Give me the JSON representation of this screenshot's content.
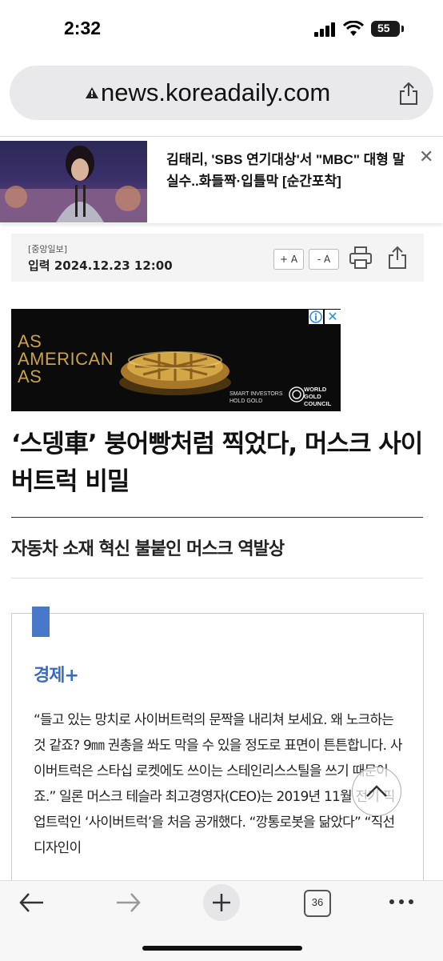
{
  "status_bar": {
    "time": "2:32",
    "battery": "55"
  },
  "browser": {
    "url": "news.koreadaily.com",
    "tab_count": "36"
  },
  "top_banner": {
    "title": "김태리, 'SBS 연기대상'서 \"MBC\" 대형 말실수..화들짝·입틀막 [순간포착]"
  },
  "article_meta": {
    "source": "[중앙일보]",
    "date": "입력 2024.12.23 12:00",
    "font_plus": "+ A",
    "font_minus": "- A"
  },
  "ad": {
    "headline_lines": [
      "AS",
      "AMERICAN",
      "AS"
    ],
    "tagline": "SMART INVESTORS\nHOLD GOLD",
    "brand": "WORLD\nGOLD\nCOUNCIL"
  },
  "article": {
    "headline": "‘스뎅車’ 붕어빵처럼 찍었다, 머스크 사이버트럭 비밀",
    "subheadline": "자동차 소재 혁신 불붙인 머스크 역발상",
    "section": "경제+",
    "body": "“들고 있는 망치로 사이버트럭의 문짝을 내리쳐 보세요. 왜 노크하는 것 같죠? 9㎜ 권총을 쏴도 막을 수 있을 정도로 표면이 튼튼합니다. 사이버트럭은 스타십 로켓에도 쓰이는 스테인리스스틸을 쓰기 때문이죠.” 일론 머스크 테슬라 최고경영자(CEO)는 2019년 11월 전기 픽업트럭인 ‘사이버트럭’을 처음 공개했다. “깡통로봇을 닮았다” “직선 디자인이"
  },
  "colors": {
    "accent_blue": "#3a6bc4",
    "ad_gold": "#c9a24a"
  }
}
